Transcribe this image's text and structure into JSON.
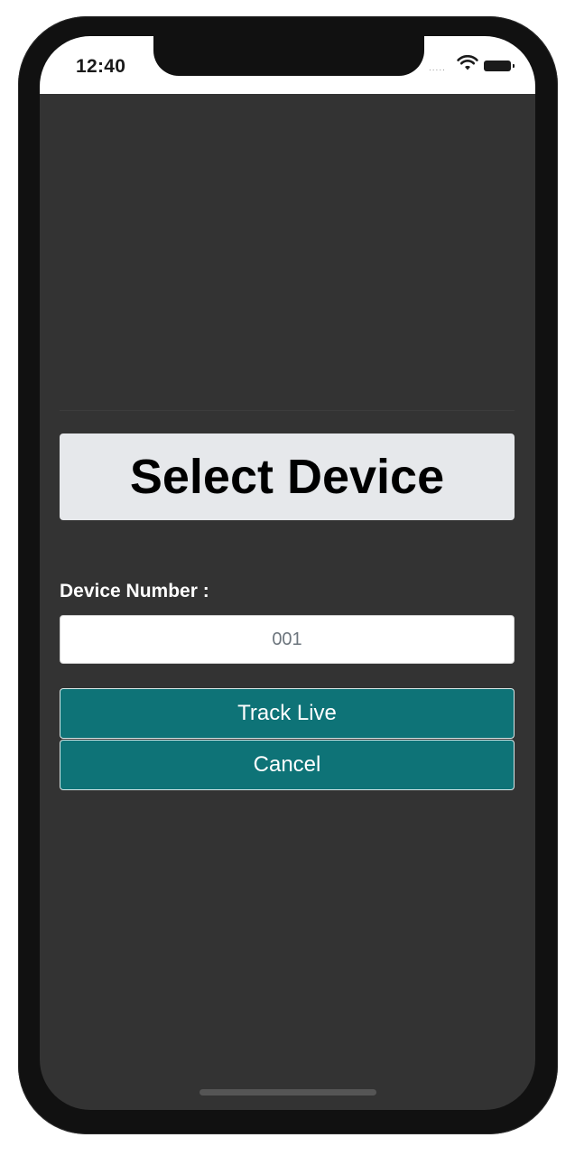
{
  "status_bar": {
    "time": "12:40",
    "signal_dots": ".....",
    "icons": [
      "wifi-icon",
      "battery-icon"
    ]
  },
  "main": {
    "title": "Select Device",
    "device_number_label": "Device Number :",
    "device_number_value": "",
    "device_number_placeholder": "001",
    "track_live_label": "Track Live",
    "cancel_label": "Cancel"
  },
  "colors": {
    "background": "#333333",
    "title_box": "#e6e8eb",
    "button": "#0e7377",
    "status_bar": "#ffffff"
  }
}
